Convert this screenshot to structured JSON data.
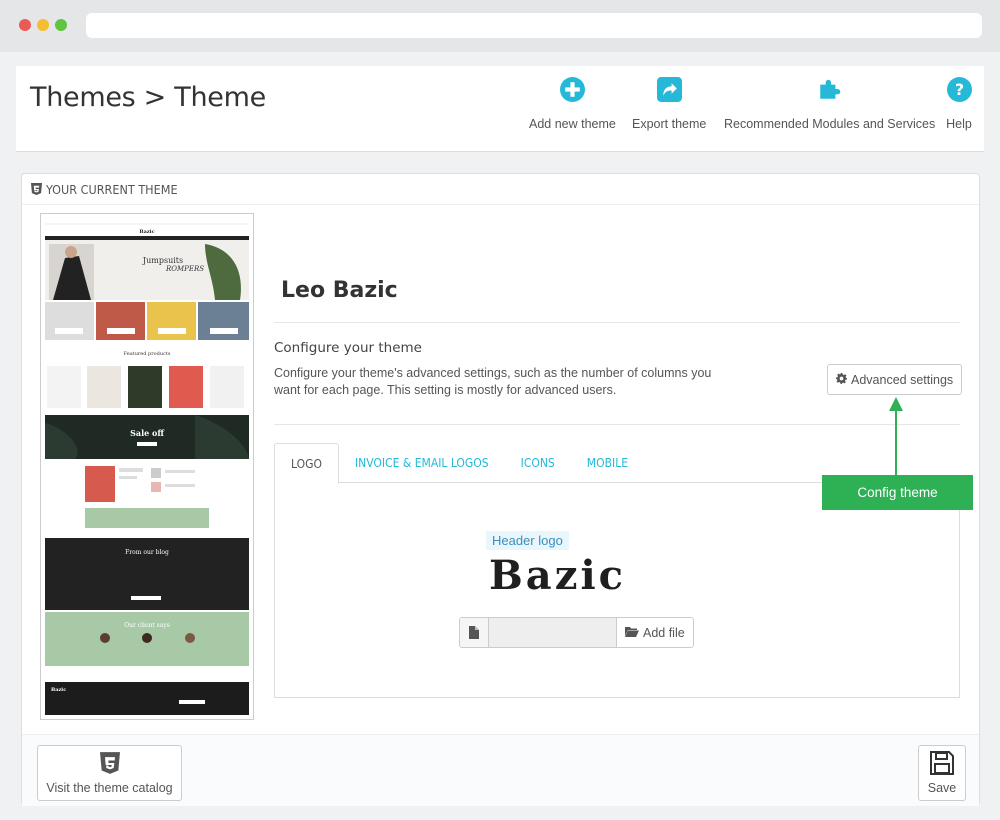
{
  "header": {
    "breadcrumb": "Themes > Theme",
    "toolbar": {
      "add_new_theme": "Add new theme",
      "export_theme": "Export theme",
      "recommended_modules": "Recommended Modules and Services",
      "help": "Help"
    }
  },
  "panel": {
    "heading": "YOUR CURRENT THEME",
    "theme_name": "Leo Bazic",
    "configure": {
      "title": "Configure your theme",
      "description": "Configure your theme's advanced settings, such as the number of columns you want for each page. This setting is mostly for advanced users.",
      "advanced_settings_label": "Advanced settings"
    },
    "tabs": [
      {
        "label": "LOGO",
        "active": true
      },
      {
        "label": "INVOICE & EMAIL LOGOS",
        "active": false
      },
      {
        "label": "ICONS",
        "active": false
      },
      {
        "label": "MOBILE",
        "active": false
      }
    ],
    "logo_tab": {
      "header_logo_label": "Header logo",
      "logo_text": "Bazic",
      "add_file_label": "Add file"
    },
    "annotation": {
      "label": "Config theme",
      "color": "#2eb155"
    },
    "preview": {
      "brand": "Bazic",
      "hero_line1": "Jumpsuits",
      "hero_line2": "ROMPERS",
      "featured": "Featured products",
      "sale": "Sale off",
      "blog": "From our blog",
      "testimonials": "Our client says"
    }
  },
  "footer": {
    "visit_catalog": "Visit the theme catalog",
    "save": "Save"
  },
  "colors": {
    "accent": "#25b9d7",
    "annotation_green": "#2eb155"
  }
}
